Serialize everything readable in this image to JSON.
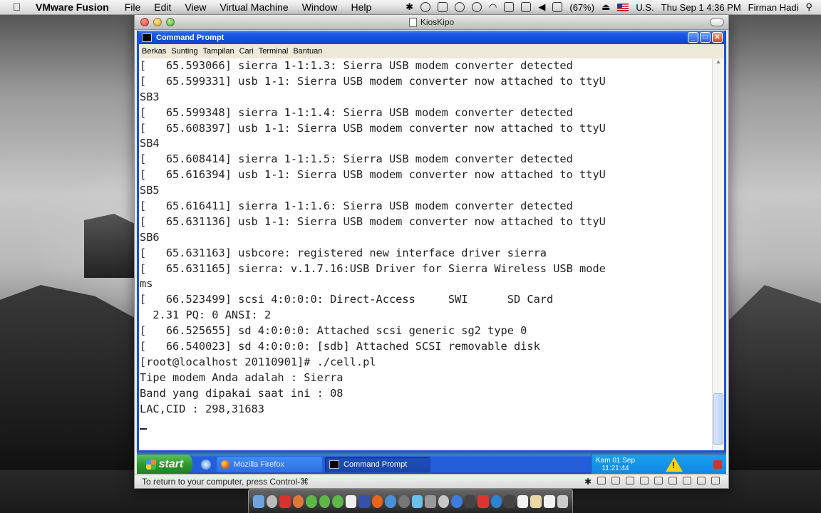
{
  "menubar": {
    "app": "VMware Fusion",
    "items": [
      "File",
      "Edit",
      "View",
      "Virtual Machine",
      "Window",
      "Help"
    ],
    "battery": "(67%)",
    "input_source": "U.S.",
    "datetime": "Thu Sep 1  4:36 PM",
    "user": "Firman Hadi"
  },
  "vm_window": {
    "title": "KiosKipo",
    "status_message": "To return to your computer, press Control-⌘"
  },
  "cmd_window": {
    "title": "Command Prompt",
    "menu": [
      "Berkas",
      "Sunting",
      "Tampilan",
      "Cari",
      "Terminal",
      "Bantuan"
    ],
    "lines": [
      "[   65.593066] sierra 1-1:1.3: Sierra USB modem converter detected",
      "[   65.599331] usb 1-1: Sierra USB modem converter now attached to ttyU",
      "SB3",
      "[   65.599348] sierra 1-1:1.4: Sierra USB modem converter detected",
      "[   65.608397] usb 1-1: Sierra USB modem converter now attached to ttyU",
      "SB4",
      "[   65.608414] sierra 1-1:1.5: Sierra USB modem converter detected",
      "[   65.616394] usb 1-1: Sierra USB modem converter now attached to ttyU",
      "SB5",
      "[   65.616411] sierra 1-1:1.6: Sierra USB modem converter detected",
      "[   65.631136] usb 1-1: Sierra USB modem converter now attached to ttyU",
      "SB6",
      "[   65.631163] usbcore: registered new interface driver sierra",
      "[   65.631165] sierra: v.1.7.16:USB Driver for Sierra Wireless USB mode",
      "ms",
      "[   66.523499] scsi 4:0:0:0: Direct-Access     SWI      SD Card",
      "  2.31 PQ: 0 ANSI: 2",
      "[   66.525655] sd 4:0:0:0: Attached scsi generic sg2 type 0",
      "[   66.540023] sd 4:0:0:0: [sdb] Attached SCSI removable disk",
      "[root@localhost 20110901]# ./cell.pl",
      "Tipe modem Anda adalah : Sierra",
      "Band yang dipakai saat ini : 08",
      "LAC,CID : 298,31683"
    ]
  },
  "taskbar": {
    "start_label": "start",
    "tasks": [
      "Mozilla Firefox",
      "Command Prompt"
    ],
    "clock_day": "Kam 01 Sep",
    "clock_time": "11:21:44"
  }
}
